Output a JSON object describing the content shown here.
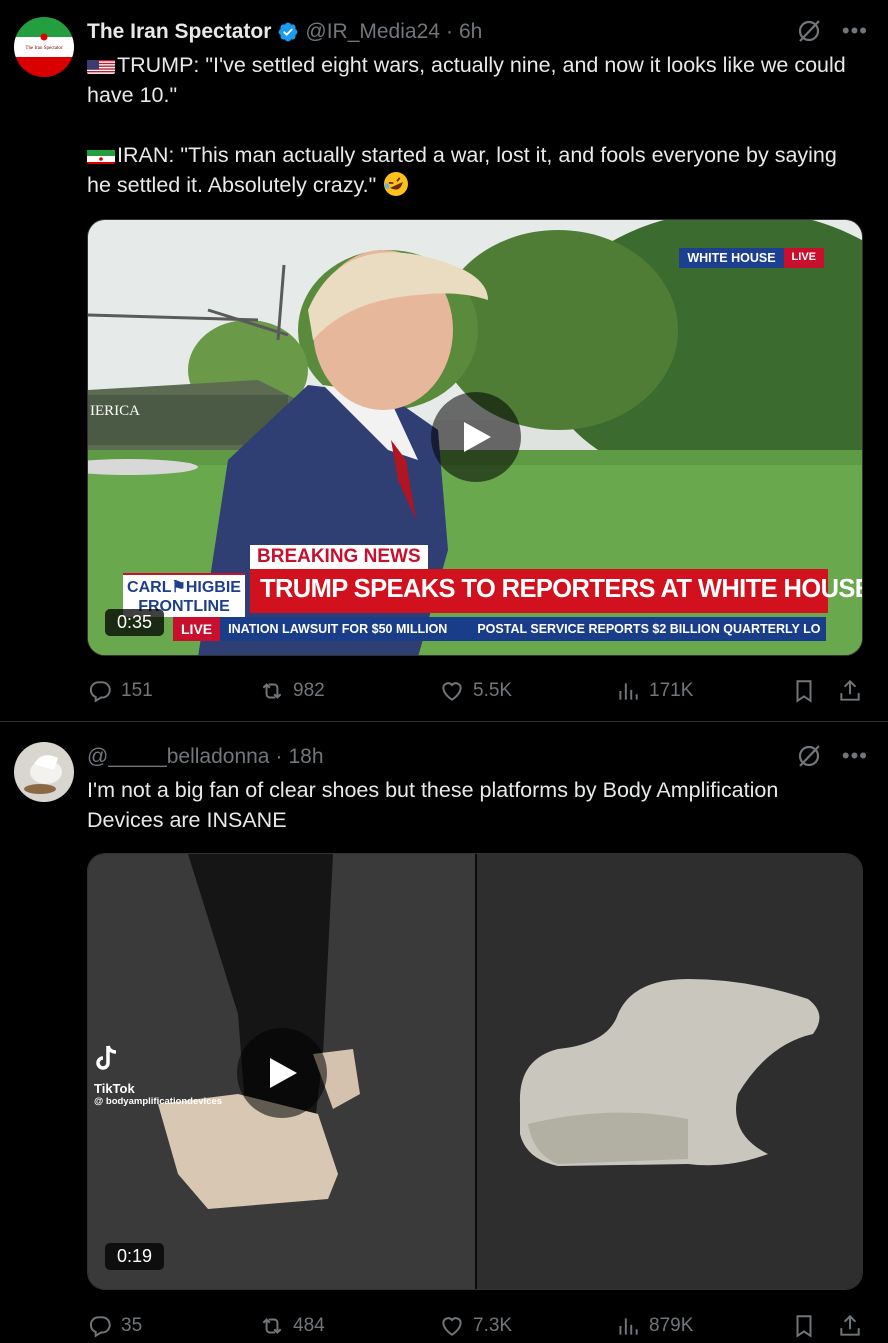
{
  "posts": [
    {
      "display_name": "The Iran Spectator",
      "handle": "@IR_Media24",
      "separator": "·",
      "time": "6h",
      "avatar_text": "The Iran Spectator",
      "text_line1": "TRUMP: \"I've settled eight wars, actually nine, and now it looks like we could have 10.\"",
      "text_line2": "IRAN: \"This man actually started a war, lost it, and fools everyone by saying he settled it. Absolutely crazy.\"",
      "video": {
        "duration": "0:35",
        "bug_label": "WHITE HOUSE",
        "bug_live": "LIVE",
        "breaking": "BREAKING NEWS",
        "headline": "TRUMP SPEAKS TO REPORTERS AT WHITE HOUSE",
        "show_logo_line1": "CARL⚑HIGBIE",
        "show_logo_line2": "FRONTLINE",
        "ticker_live": "LIVE",
        "ticker_1": "INATION LAWSUIT FOR $50 MILLION",
        "ticker_2": "POSTAL SERVICE REPORTS $2 BILLION QUARTERLY LO",
        "scene_text": "IERICA"
      },
      "stats": {
        "replies": "151",
        "reposts": "982",
        "likes": "5.5K",
        "views": "171K"
      }
    },
    {
      "display_name": "",
      "handle": "@_____belladonna",
      "separator": "·",
      "time": "18h",
      "text": "I'm not a big fan of clear shoes but these platforms by Body Amplification Devices are INSANE",
      "video": {
        "duration": "0:19",
        "tiktok_name": "TikTok",
        "tiktok_handle": "@ bodyamplificationdevices"
      },
      "stats": {
        "replies": "35",
        "reposts": "484",
        "likes": "7.3K",
        "views": "879K"
      }
    }
  ],
  "colors": {
    "background": "#000000",
    "text": "#e7e9ea",
    "muted": "#71767b",
    "verified": "#1d9bf0",
    "divider": "#2f3336"
  }
}
